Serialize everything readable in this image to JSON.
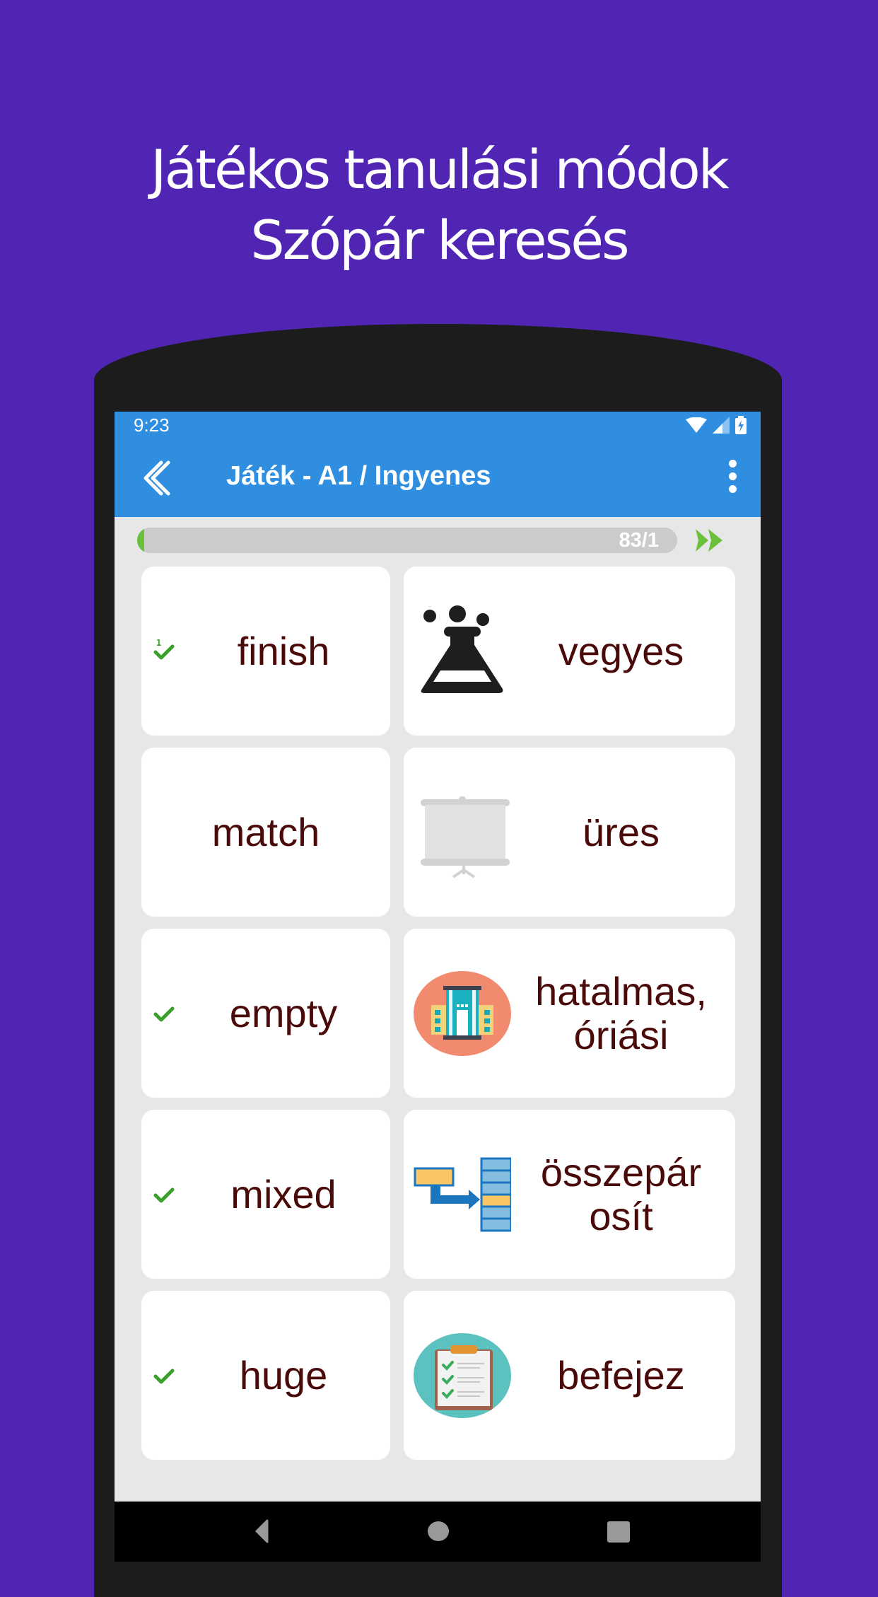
{
  "promo": {
    "line1": "Játékos tanulási módok",
    "line2": "Szópár keresés"
  },
  "statusbar": {
    "time": "9:23",
    "icons": [
      "wifi-icon",
      "signal-icon",
      "battery-charging-icon"
    ]
  },
  "appbar": {
    "back_icon": "double-chevron-left-icon",
    "title": "Játék - A1 / Ingyenes",
    "menu_icon": "more-vert-icon"
  },
  "progress": {
    "label": "83/1",
    "fill_fraction": 0.012,
    "skip_icon": "fast-forward-icon"
  },
  "colors": {
    "background": "#5025b4",
    "appbar": "#2f8ee0",
    "accent_green": "#6abf3b",
    "word_text": "#4a0a0a",
    "card_bg": "#ffffff",
    "screen_bg": "#e7e7e7"
  },
  "pairs": [
    {
      "left": {
        "word": "finish",
        "checked": true,
        "check_count": "1"
      },
      "right": {
        "word": "vegyes",
        "icon": "flask-icon"
      }
    },
    {
      "left": {
        "word": "match",
        "checked": false
      },
      "right": {
        "word": "üres",
        "icon": "projector-screen-icon"
      }
    },
    {
      "left": {
        "word": "empty",
        "checked": true
      },
      "right": {
        "word": "hatalmas, óriási",
        "icon": "building-icon"
      }
    },
    {
      "left": {
        "word": "mixed",
        "checked": true
      },
      "right": {
        "word": "összepár osít",
        "icon": "match-arrow-icon"
      }
    },
    {
      "left": {
        "word": "huge",
        "checked": true
      },
      "right": {
        "word": "befejez",
        "icon": "checklist-clipboard-icon"
      }
    }
  ],
  "navbar": {
    "buttons": [
      "nav-back-icon",
      "nav-home-icon",
      "nav-recents-icon"
    ]
  }
}
